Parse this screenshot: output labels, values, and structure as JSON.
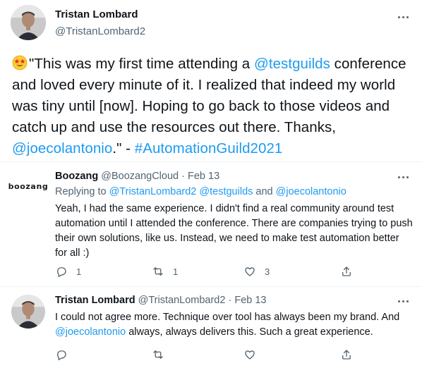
{
  "main_tweet": {
    "author_name": "Tristan Lombard",
    "author_handle": "@TristanLombard2",
    "text_parts": [
      {
        "t": "\"This was my first time attending a ",
        "link": false
      },
      {
        "t": "@testguilds",
        "link": true
      },
      {
        "t": " conference and loved every minute of it. I realized that indeed my world was tiny until [now]. Hoping to go back to those videos and catch up and use the resources out there. Thanks, ",
        "link": false
      },
      {
        "t": "@joecolantonio",
        "link": true
      },
      {
        "t": ".\" - ",
        "link": false
      },
      {
        "t": "#AutomationGuild2021",
        "link": true
      }
    ],
    "leading_emoji": "star-struck-emoji"
  },
  "reply1": {
    "logo_text": "boozang",
    "author_name": "Boozang",
    "author_handle": "@BoozangCloud",
    "separator": "·",
    "date": "Feb 13",
    "replying_prefix": "Replying to ",
    "replying_to_1": "@TristanLombard2",
    "replying_to_2": "@testguilds",
    "replying_and": " and ",
    "replying_to_3": "@joecolantonio",
    "text": "Yeah, I had the same experience. I didn't find a real community around test automation until I attended the conference. There are companies trying to push their own solutions, like us. Instead, we need to make test automation better for all :)",
    "reply_count": "1",
    "retweet_count": "1",
    "like_count": "3"
  },
  "reply2": {
    "author_name": "Tristan Lombard",
    "author_handle": "@TristanLombard2",
    "separator": "·",
    "date": "Feb 13",
    "text_before": "I could not agree more. Technique over tool has always been my brand. And ",
    "mention": "@joecolantonio",
    "text_after": " always, always delivers this. Such a great experience."
  },
  "colors": {
    "link": "#1d9bf0",
    "muted": "#536471",
    "divider": "#eff3f4"
  }
}
